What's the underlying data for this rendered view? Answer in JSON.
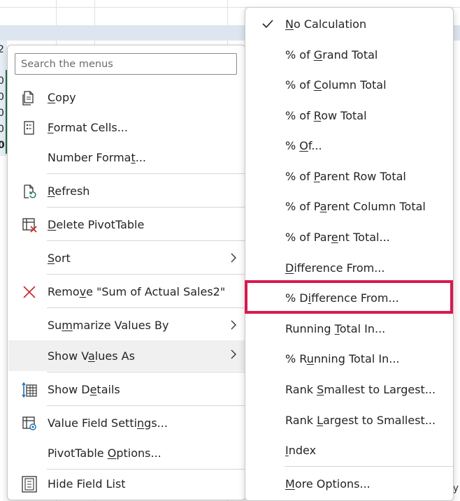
{
  "left_menu": {
    "search_placeholder": "Search the menus",
    "items": [
      {
        "id": "copy",
        "label_pre": "",
        "label_ul": "C",
        "label_post": "opy",
        "icon": "copy-icon"
      },
      {
        "id": "format-cells",
        "label_pre": "",
        "label_ul": "F",
        "label_post": "ormat Cells...",
        "icon": "format-cells-icon"
      },
      {
        "id": "number-format",
        "label_pre": "Number Forma",
        "label_ul": "t",
        "label_post": "...",
        "icon": ""
      },
      {
        "id": "refresh",
        "label_pre": "",
        "label_ul": "R",
        "label_post": "efresh",
        "icon": "refresh-icon"
      },
      {
        "id": "delete-pivottable",
        "label_pre": "",
        "label_ul": "D",
        "label_post": "elete PivotTable",
        "icon": "delete-pivottable-icon"
      },
      {
        "id": "sort",
        "label_pre": "",
        "label_ul": "S",
        "label_post": "ort",
        "icon": ""
      },
      {
        "id": "remove",
        "label_pre": "Remo",
        "label_ul": "v",
        "label_post": "e \"Sum of Actual Sales2\"",
        "icon": "remove-x-icon"
      },
      {
        "id": "summarize",
        "label_pre": "Su",
        "label_ul": "m",
        "label_post": "marize Values By",
        "icon": ""
      },
      {
        "id": "show-values-as",
        "label_pre": "Show V",
        "label_ul": "a",
        "label_post": "lues As",
        "icon": ""
      },
      {
        "id": "show-details",
        "label_pre": "Show D",
        "label_ul": "e",
        "label_post": "tails",
        "icon": "show-details-icon"
      },
      {
        "id": "value-field-settings",
        "label_pre": "Value Field Setti",
        "label_ul": "n",
        "label_post": "gs...",
        "icon": "value-field-settings-icon"
      },
      {
        "id": "pivottable-options",
        "label_pre": "PivotTable ",
        "label_ul": "O",
        "label_post": "ptions...",
        "icon": ""
      },
      {
        "id": "hide-field-list",
        "label_pre": "Hide Field List",
        "label_ul": "",
        "label_post": "",
        "icon": "field-list-icon"
      }
    ]
  },
  "right_menu": {
    "items": [
      {
        "id": "no-calculation",
        "label_pre": "",
        "label_ul": "N",
        "label_post": "o Calculation",
        "checked": true
      },
      {
        "id": "pct-grand-total",
        "label_pre": "% of ",
        "label_ul": "G",
        "label_post": "rand Total",
        "checked": false
      },
      {
        "id": "pct-column-total",
        "label_pre": "% of ",
        "label_ul": "C",
        "label_post": "olumn Total",
        "checked": false
      },
      {
        "id": "pct-row-total",
        "label_pre": "% of ",
        "label_ul": "R",
        "label_post": "ow Total",
        "checked": false
      },
      {
        "id": "pct-of",
        "label_pre": "% ",
        "label_ul": "O",
        "label_post": "f...",
        "checked": false
      },
      {
        "id": "pct-parent-row-total",
        "label_pre": "% of ",
        "label_ul": "P",
        "label_post": "arent Row Total",
        "checked": false
      },
      {
        "id": "pct-parent-column-total",
        "label_pre": "% of P",
        "label_ul": "a",
        "label_post": "rent Column Total",
        "checked": false
      },
      {
        "id": "pct-parent-total",
        "label_pre": "% of Par",
        "label_ul": "e",
        "label_post": "nt Total...",
        "checked": false
      },
      {
        "id": "difference-from",
        "label_pre": "",
        "label_ul": "D",
        "label_post": "ifference From...",
        "checked": false
      },
      {
        "id": "pct-difference-from",
        "label_pre": "% D",
        "label_ul": "i",
        "label_post": "fference From...",
        "checked": false
      },
      {
        "id": "running-total-in",
        "label_pre": "Running ",
        "label_ul": "T",
        "label_post": "otal In...",
        "checked": false
      },
      {
        "id": "pct-running-total-in",
        "label_pre": "% R",
        "label_ul": "u",
        "label_post": "nning Total In...",
        "checked": false
      },
      {
        "id": "rank-smallest",
        "label_pre": "Rank ",
        "label_ul": "S",
        "label_post": "mallest to Largest...",
        "checked": false
      },
      {
        "id": "rank-largest",
        "label_pre": "Rank ",
        "label_ul": "L",
        "label_post": "argest to Smallest...",
        "checked": false
      },
      {
        "id": "index",
        "label_pre": "",
        "label_ul": "I",
        "label_post": "ndex",
        "checked": false
      },
      {
        "id": "more-options",
        "label_pre": "",
        "label_ul": "M",
        "label_post": "ore Options...",
        "checked": false
      }
    ]
  },
  "sheet": {
    "edge_digits": [
      "2",
      "0",
      "0",
      "0",
      "0",
      "0"
    ],
    "corner_char": "y"
  },
  "colors": {
    "highlight": "#d7194d",
    "excel_green": "#217346"
  }
}
